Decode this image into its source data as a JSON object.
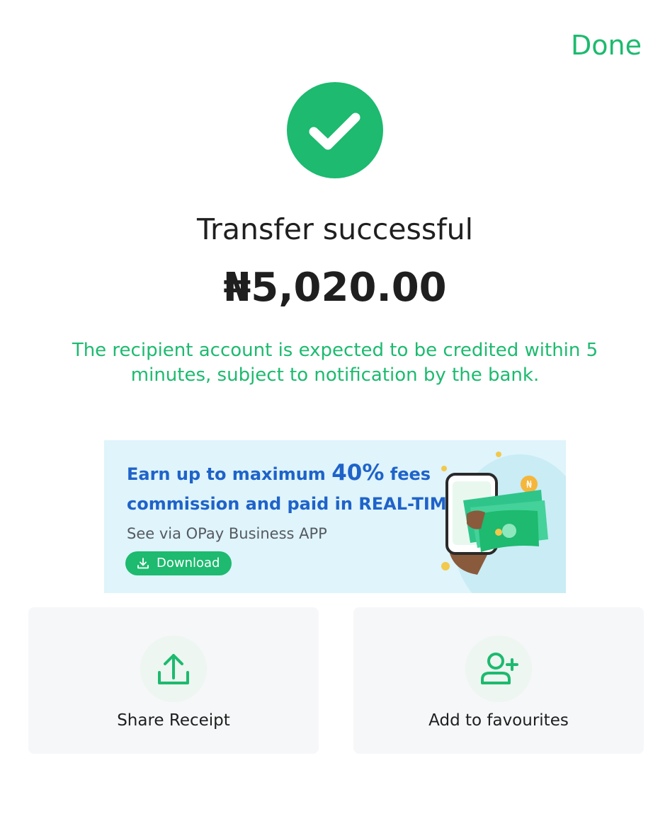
{
  "header": {
    "done_label": "Done"
  },
  "status": {
    "icon": "check-icon",
    "title": "Transfer successful",
    "amount": "₦5,020.00",
    "notice": "The recipient account is expected to be credited within 5 minutes, subject to notification by the bank."
  },
  "banner": {
    "line1_prefix": "Earn up to maximum",
    "line1_highlight": "40%",
    "line1_suffix": "fees",
    "line2": "commission and paid in REAL-TIME",
    "subtitle": "See via OPay Business APP",
    "download_label": "Download",
    "download_icon": "download-icon"
  },
  "actions": [
    {
      "label": "Share Receipt",
      "icon": "share-upload-icon"
    },
    {
      "label": "Add to favourites",
      "icon": "add-user-icon"
    }
  ],
  "colors": {
    "accent": "#1dba6f",
    "banner_text": "#1f63c9",
    "banner_bg": "#dff4fb",
    "card_bg": "#f6f7f9",
    "text": "#1f1f1f"
  }
}
